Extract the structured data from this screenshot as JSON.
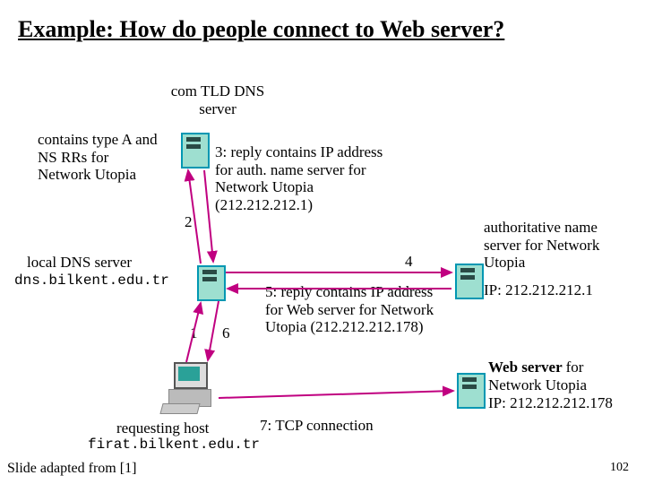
{
  "title": "Example: How do people connect to Web server?",
  "tld": {
    "label": "com TLD DNS server",
    "note": "contains type A and NS RRs for Network Utopia"
  },
  "step3": "3: reply contains IP address for auth. name server for Network Utopia (212.212.212.1)",
  "step_nums": {
    "n1": "1",
    "n2": "2",
    "n4": "4",
    "n5": "5:",
    "n6": "6",
    "n7": "7:"
  },
  "step5": "reply contains IP address for Web server for Network Utopia (212.212.212.178)",
  "step7": "TCP connection",
  "local_dns": {
    "label": "local DNS server",
    "host": "dns.bilkent.edu.tr"
  },
  "auth": {
    "label": "authoritative name server for Network Utopia",
    "ip": "IP: 212.212.212.1"
  },
  "web": {
    "label_prefix": "Web server ",
    "label_rest": "for Network Utopia",
    "ip": "IP: 212.212.212.178"
  },
  "req_host": {
    "label": "requesting host",
    "host": "firat.bilkent.edu.tr"
  },
  "credit": "Slide adapted from [1]",
  "slide_number": "102",
  "chart_data": {
    "type": "diagram",
    "nodes": [
      {
        "id": "tld",
        "label": "com TLD DNS server",
        "kind": "dns-server",
        "meta": "contains type A and NS RRs for Network Utopia"
      },
      {
        "id": "local",
        "label": "local DNS server",
        "kind": "dns-server",
        "host": "dns.bilkent.edu.tr"
      },
      {
        "id": "auth",
        "label": "authoritative name server for Network Utopia",
        "kind": "dns-server",
        "ip": "212.212.212.1"
      },
      {
        "id": "web",
        "label": "Web server for Network Utopia",
        "kind": "web-server",
        "ip": "212.212.212.178"
      },
      {
        "id": "client",
        "label": "requesting host",
        "kind": "host",
        "host": "firat.bilkent.edu.tr"
      }
    ],
    "edges": [
      {
        "step": 1,
        "from": "client",
        "to": "local"
      },
      {
        "step": 2,
        "from": "local",
        "to": "tld"
      },
      {
        "step": 3,
        "from": "tld",
        "to": "local",
        "reply": "IP address for auth. name server for Network Utopia (212.212.212.1)"
      },
      {
        "step": 4,
        "from": "local",
        "to": "auth"
      },
      {
        "step": 5,
        "from": "auth",
        "to": "local",
        "reply": "IP address for Web server for Network Utopia (212.212.212.178)"
      },
      {
        "step": 6,
        "from": "local",
        "to": "client"
      },
      {
        "step": 7,
        "from": "client",
        "to": "web",
        "label": "TCP connection"
      }
    ]
  }
}
